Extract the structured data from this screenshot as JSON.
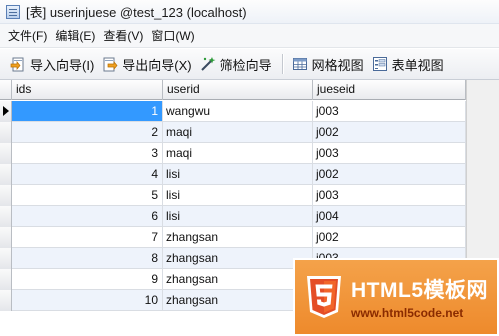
{
  "window": {
    "title": "[表] userinjuese @test_123 (localhost)"
  },
  "menu": [
    {
      "label": "文件(F)"
    },
    {
      "label": "编辑(E)"
    },
    {
      "label": "查看(V)"
    },
    {
      "label": "窗口(W)"
    }
  ],
  "toolbar": {
    "import_wizard": "导入向导(I)",
    "export_wizard": "导出向导(X)",
    "filter_wizard": "筛检向导",
    "grid_view": "网格视图",
    "form_view": "表单视图"
  },
  "table": {
    "columns": [
      "ids",
      "userid",
      "jueseid"
    ],
    "rows": [
      {
        "ids": "1",
        "userid": "wangwu",
        "jueseid": "j003"
      },
      {
        "ids": "2",
        "userid": "maqi",
        "jueseid": "j002"
      },
      {
        "ids": "3",
        "userid": "maqi",
        "jueseid": "j003"
      },
      {
        "ids": "4",
        "userid": "lisi",
        "jueseid": "j002"
      },
      {
        "ids": "5",
        "userid": "lisi",
        "jueseid": "j003"
      },
      {
        "ids": "6",
        "userid": "lisi",
        "jueseid": "j004"
      },
      {
        "ids": "7",
        "userid": "zhangsan",
        "jueseid": "j002"
      },
      {
        "ids": "8",
        "userid": "zhangsan",
        "jueseid": "j003"
      },
      {
        "ids": "9",
        "userid": "zhangsan",
        "jueseid": ""
      },
      {
        "ids": "10",
        "userid": "zhangsan",
        "jueseid": ""
      }
    ],
    "selected_row": 0
  },
  "watermark": {
    "title": "HTML5模板网",
    "url": "www.html5code.net"
  },
  "colors": {
    "selection": "#3399ff",
    "row_alt": "#eef3fb",
    "watermark": "#ee8a2c"
  }
}
